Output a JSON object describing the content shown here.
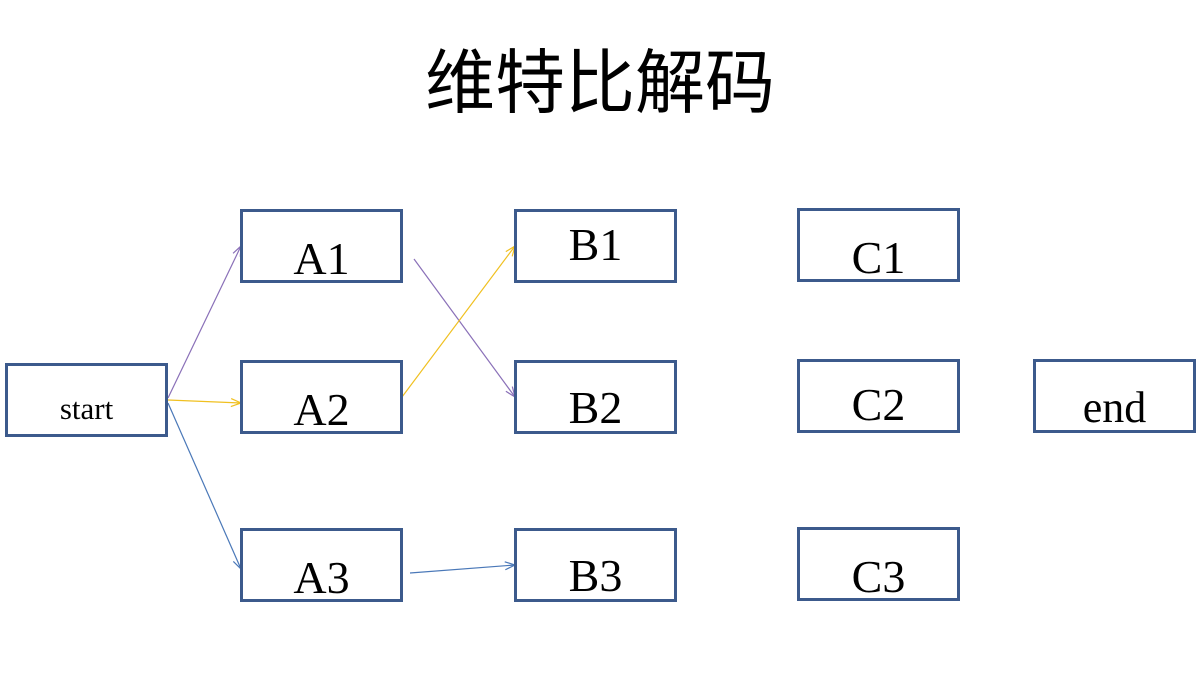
{
  "title": "维特比解码",
  "nodes": {
    "start": "start",
    "A1": "A1",
    "A2": "A2",
    "A3": "A3",
    "B1": "B1",
    "B2": "B2",
    "B3": "B3",
    "C1": "C1",
    "C2": "C2",
    "C3": "C3",
    "end": "end"
  },
  "edges": [
    {
      "from": "start",
      "to": "A1",
      "color": "#8a70b8"
    },
    {
      "from": "start",
      "to": "A2",
      "color": "#f0c020"
    },
    {
      "from": "start",
      "to": "A3",
      "color": "#4a78b8"
    },
    {
      "from": "A1",
      "to": "B2",
      "color": "#8a70b8"
    },
    {
      "from": "A2",
      "to": "B1",
      "color": "#f0c020"
    },
    {
      "from": "A3",
      "to": "B3",
      "color": "#4a78b8"
    }
  ],
  "colors": {
    "box_border": "#3c5a8c"
  }
}
